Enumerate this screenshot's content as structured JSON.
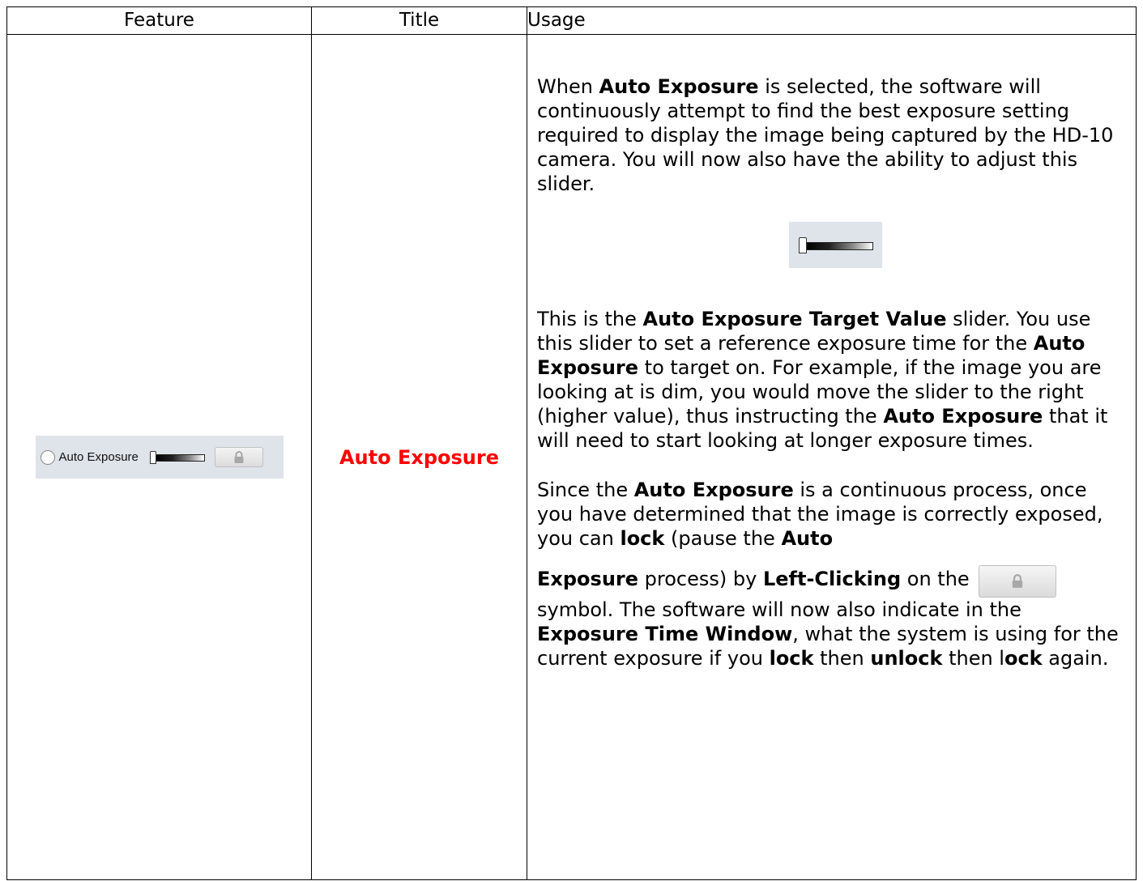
{
  "table": {
    "headers": {
      "feature": "Feature",
      "title": "Title",
      "usage": "Usage"
    }
  },
  "row": {
    "feature": {
      "radio_label": "Auto Exposure",
      "icons": [
        "radio-button",
        "exposure-slider",
        "lock-icon"
      ]
    },
    "title": {
      "text": "Auto Exposure",
      "color": "#ff0000"
    },
    "usage": {
      "p1": {
        "a": "When ",
        "b1": "Auto Exposure",
        "c": " is selected, the software will continuously attempt to find the best exposure setting required to display the image being captured by the HD-10 camera. You will now also have the ability to adjust this slider."
      },
      "p2": {
        "a": "This is the ",
        "b1": "Auto Exposure Target Value",
        "c": " slider. You use this slider to set a reference exposure time for the ",
        "b2": "Auto Exposure",
        "d": " to target on. For example, if the image you are looking at is dim, you would move the slider to the right (higher value), thus instructing the ",
        "b3": "Auto Exposure",
        "e": " that it will need to start looking at longer exposure times."
      },
      "p3": {
        "a": "Since the ",
        "b1": "Auto Exposure",
        "c": " is a continuous process, once you have determined that the image is correctly exposed, you can ",
        "b2": "lock",
        "d": " (pause the ",
        "b3": "Auto"
      },
      "p4": {
        "b1": "Exposure",
        "a": " process) by ",
        "b2": "Left-Clicking",
        "c": " on the ",
        "d": " symbol. The software will now also indicate in the ",
        "b3": "Exposure Time Window",
        "e": ", what the system is using for the current exposure if you ",
        "b4": "lock",
        "f": " then ",
        "b5": "unlock",
        "g": " then l",
        "b6": "ock",
        "h": " again."
      }
    }
  },
  "colors": {
    "panel_bg": "#dfe3ea",
    "title_red": "#ff0000"
  }
}
